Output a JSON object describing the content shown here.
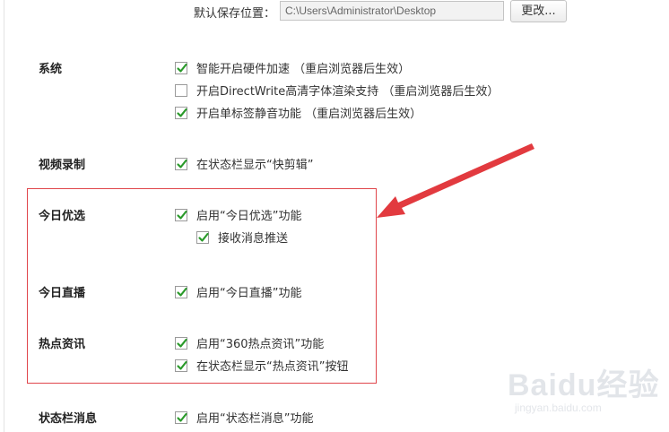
{
  "save_location": {
    "label": "默认保存位置：",
    "path_value": "C:\\Users\\Administrator\\Desktop",
    "change_button": "更改..."
  },
  "sections": {
    "system": {
      "title": "系统",
      "options": [
        {
          "label": "智能开启硬件加速 （重启浏览器后生效）",
          "checked": true
        },
        {
          "label": "开启DirectWrite高清字体渲染支持 （重启浏览器后生效）",
          "checked": false
        },
        {
          "label": "开启单标签静音功能 （重启浏览器后生效）",
          "checked": true
        }
      ]
    },
    "video": {
      "title": "视频录制",
      "options": [
        {
          "label": "在状态栏显示“快剪辑”",
          "checked": true
        }
      ]
    },
    "today_pick": {
      "title": "今日优选",
      "options": [
        {
          "label": "启用“今日优选”功能",
          "checked": true
        },
        {
          "label": "接收消息推送",
          "checked": true
        }
      ]
    },
    "today_live": {
      "title": "今日直播",
      "options": [
        {
          "label": "启用“今日直播”功能",
          "checked": true
        }
      ]
    },
    "hot_news": {
      "title": "热点资讯",
      "options": [
        {
          "label": "启用“360热点资讯”功能",
          "checked": true
        },
        {
          "label": "在状态栏显示“热点资讯”按钮",
          "checked": true
        }
      ]
    },
    "status_bar_msg": {
      "title": "状态栏消息",
      "options": [
        {
          "label": "启用“状态栏消息”功能",
          "checked": true
        }
      ]
    }
  },
  "watermark": {
    "brand": "Baidu经验",
    "url": "jingyan.baidu.com"
  },
  "colors": {
    "check": "#2a9a2a",
    "highlight": "#e0464b",
    "arrow": "#e23a3f"
  },
  "icons": [
    "check-icon",
    "red-arrow-icon"
  ]
}
